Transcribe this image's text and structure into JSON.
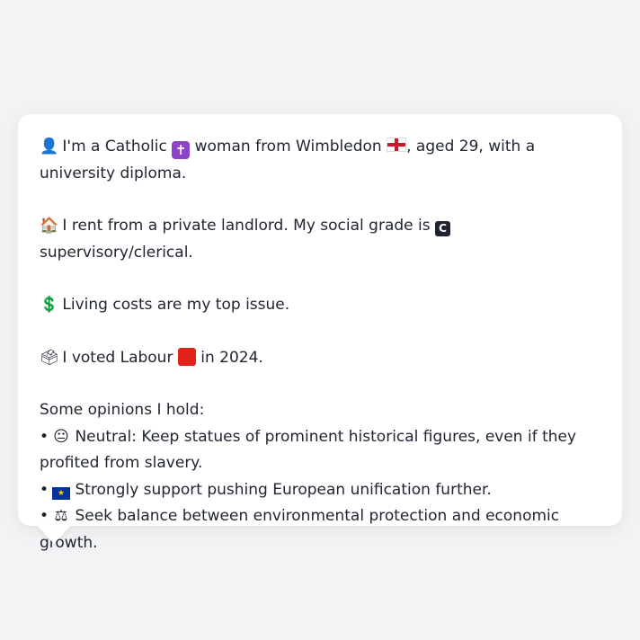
{
  "profile": {
    "intro": {
      "icon": "👤",
      "part1": "I'm a Catholic",
      "religion_icon": "✝",
      "part2": "woman from Wimbledon",
      "part3": ", aged 29, with a university diploma."
    },
    "housing": {
      "icon": "🏠",
      "part1": "I rent from a private landlord. My social grade is",
      "grade_badge": "C",
      "part2": "supervisory/clerical."
    },
    "issue": {
      "icon": "💲",
      "text": "Living costs are my top issue."
    },
    "vote": {
      "icon": "🗳",
      "part1": "I voted Labour",
      "part2": "in 2024."
    },
    "opinions": {
      "heading": "Some opinions I hold:",
      "bullet": "•",
      "items": [
        {
          "icon": "😐",
          "text": "Neutral: Keep statues of prominent historical figures, even if they profited from slavery."
        },
        {
          "icon": "★",
          "text": "Strongly support pushing European unification further."
        },
        {
          "icon": "⚖",
          "text": "Seek balance between environmental protection and economic growth."
        }
      ]
    }
  },
  "colors": {
    "background": "#f2f3f5",
    "card": "#ffffff",
    "text": "#1f2430",
    "labour_red": "#e2231a"
  }
}
